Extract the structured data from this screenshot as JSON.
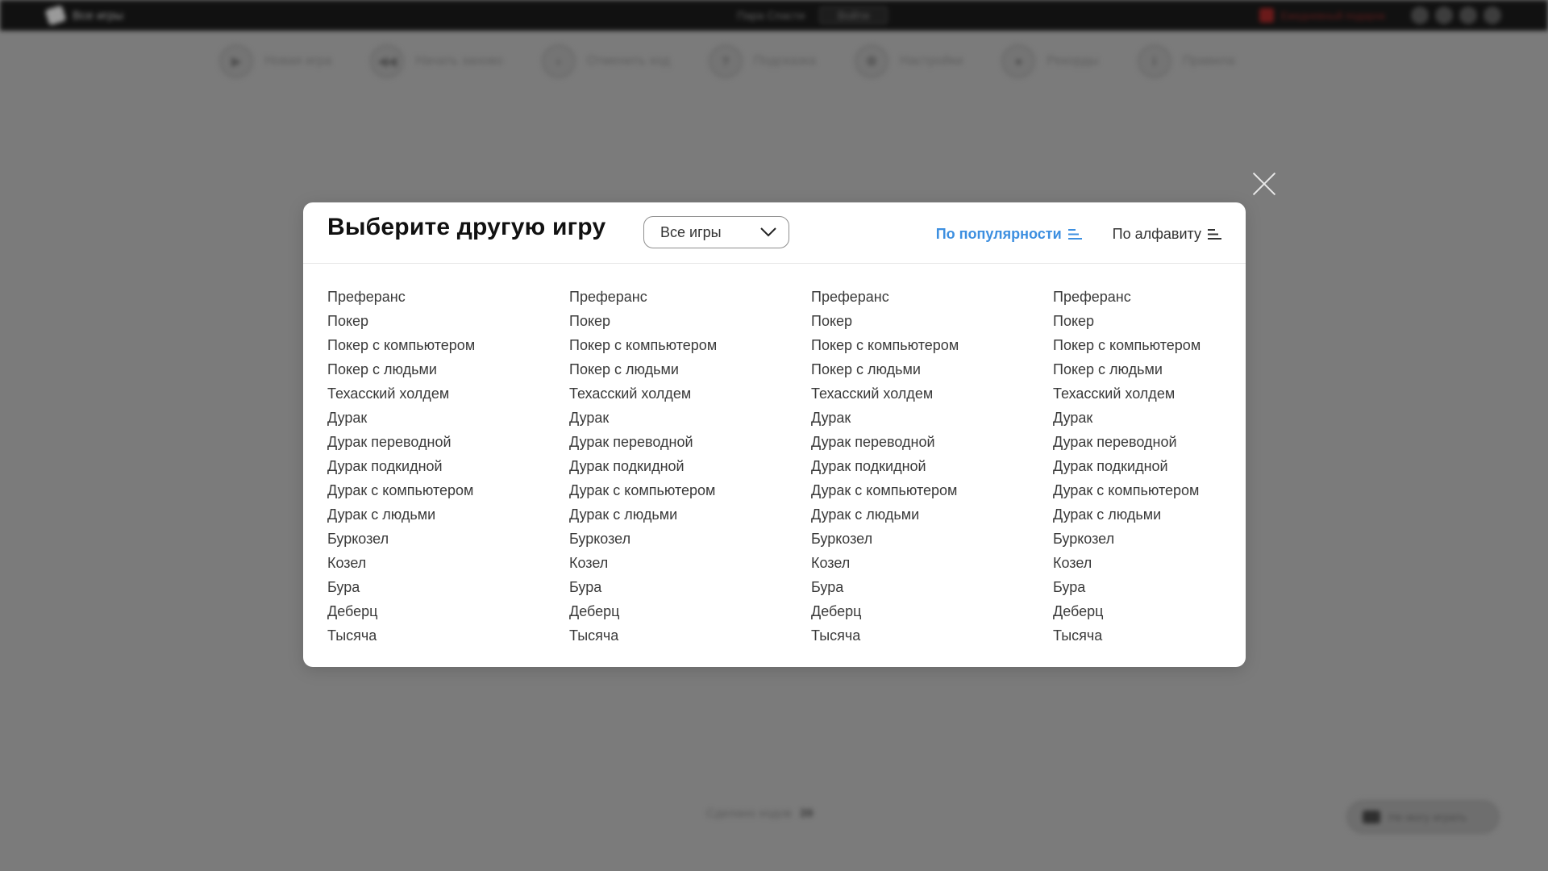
{
  "topbar": {
    "all_games": "Все игры",
    "center_text": "Пара Спасти",
    "login_label": "Войти",
    "promo_text": "Ежедневный подарок"
  },
  "toolbar": {
    "items": [
      {
        "label": "Новая игра",
        "icon": "play-icon"
      },
      {
        "label": "Начать заново",
        "icon": "rewind-icon"
      },
      {
        "label": "Отменить ход",
        "icon": "undo-icon"
      },
      {
        "label": "Подсказка",
        "icon": "hint-icon"
      },
      {
        "label": "Настройки",
        "icon": "settings-icon"
      },
      {
        "label": "Рекорды",
        "icon": "records-icon"
      },
      {
        "label": "Правила",
        "icon": "info-icon"
      }
    ]
  },
  "footer": {
    "moves_label": "Сделано ходов",
    "moves_value": "39",
    "feedback_label": "Не могу играть"
  },
  "modal": {
    "title": "Выберите другую игру",
    "select": {
      "value": "Все игры"
    },
    "sort": {
      "popularity": "По популярности",
      "alphabet": "По алфавиту",
      "active_color": "#3d8fe0"
    },
    "columns": [
      [
        "Преферанс",
        "Покер",
        "Покер с компьютером",
        "Покер с людьми",
        "Техасский холдем",
        "Дурак",
        "Дурак переводной",
        "Дурак подкидной",
        "Дурак с компьютером",
        "Дурак с людьми",
        "Буркозел",
        "Козел",
        "Бура",
        "Деберц",
        "Тысяча"
      ],
      [
        "Преферанс",
        "Покер",
        "Покер с компьютером",
        "Покер с людьми",
        "Техасский холдем",
        "Дурак",
        "Дурак переводной",
        "Дурак подкидной",
        "Дурак с компьютером",
        "Дурак с людьми",
        "Буркозел",
        "Козел",
        "Бура",
        "Деберц",
        "Тысяча"
      ],
      [
        "Преферанс",
        "Покер",
        "Покер с компьютером",
        "Покер с людьми",
        "Техасский холдем",
        "Дурак",
        "Дурак переводной",
        "Дурак подкидной",
        "Дурак с компьютером",
        "Дурак с людьми",
        "Буркозел",
        "Козел",
        "Бура",
        "Деберц",
        "Тысяча"
      ],
      [
        "Преферанс",
        "Покер",
        "Покер с компьютером",
        "Покер с людьми",
        "Техасский холдем",
        "Дурак",
        "Дурак переводной",
        "Дурак подкидной",
        "Дурак с компьютером",
        "Дурак с людьми",
        "Буркозел",
        "Козел",
        "Бура",
        "Деберц",
        "Тысяча"
      ]
    ]
  }
}
